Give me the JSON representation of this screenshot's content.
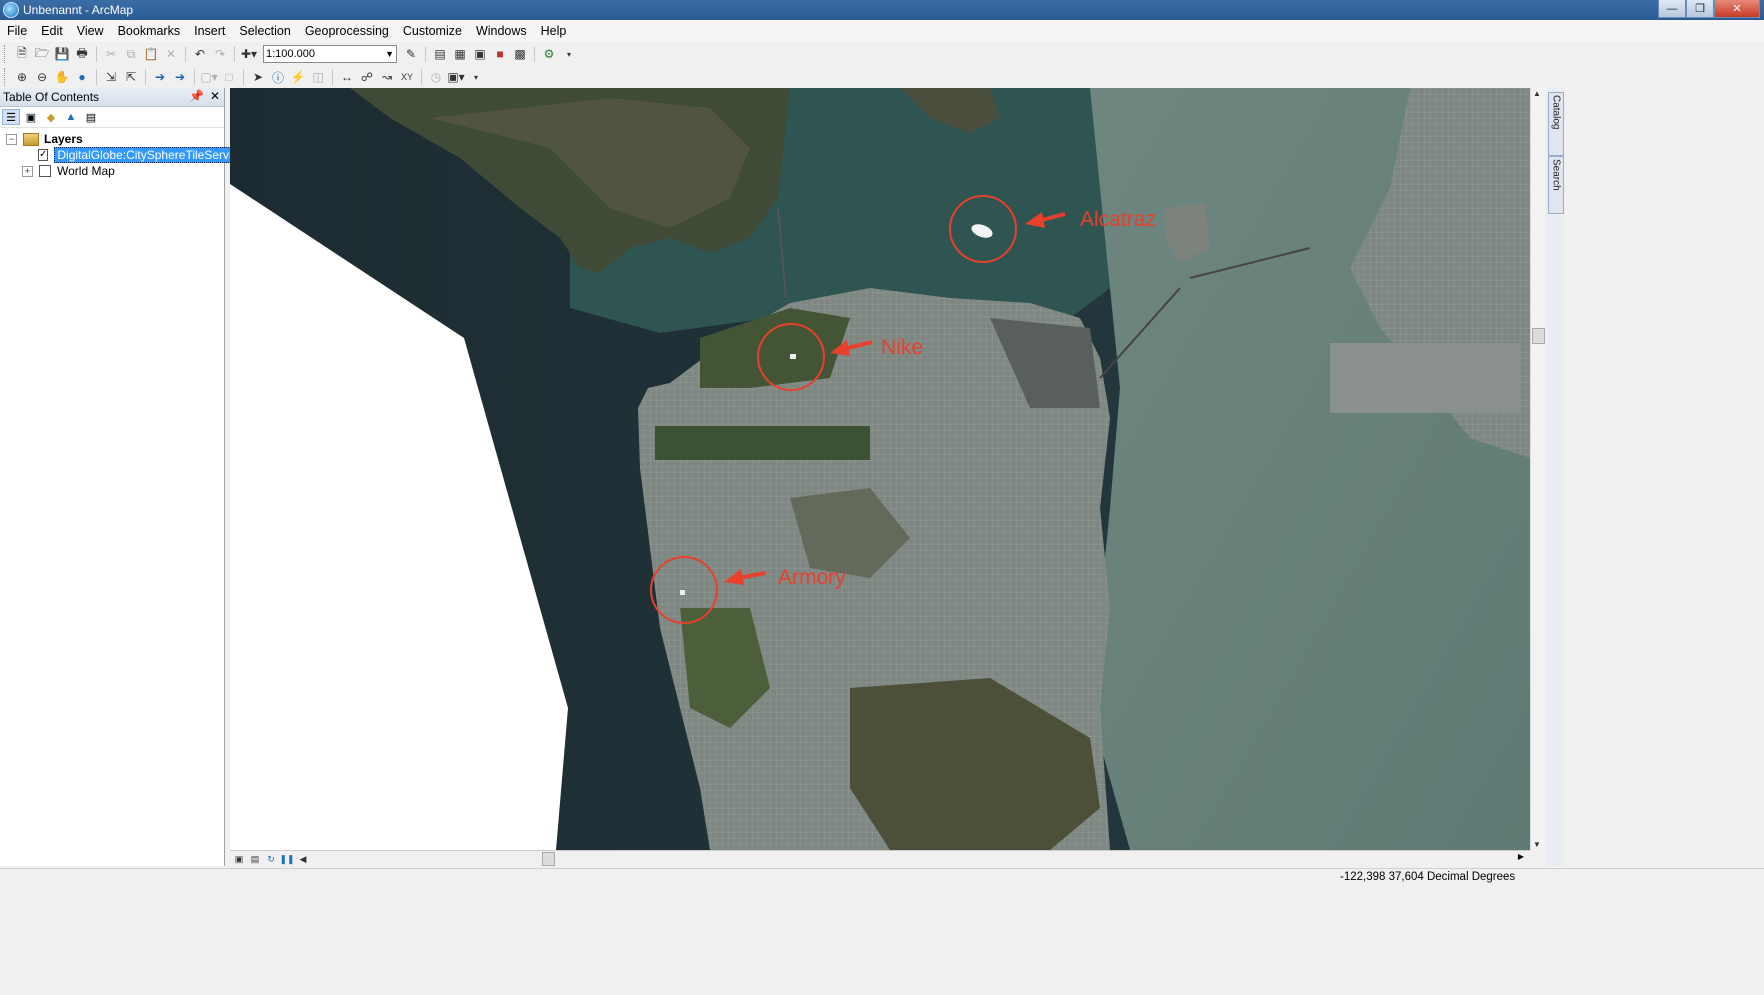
{
  "window": {
    "title": "Unbenannt - ArcMap"
  },
  "menu": [
    "File",
    "Edit",
    "View",
    "Bookmarks",
    "Insert",
    "Selection",
    "Geoprocessing",
    "Customize",
    "Windows",
    "Help"
  ],
  "toolbar": {
    "scale_value": "1:100.000"
  },
  "toc": {
    "title": "Table Of Contents",
    "root_label": "Layers",
    "layers": [
      {
        "label": "DigitalGlobe:CitySphereTileService",
        "checked": true,
        "selected": true
      },
      {
        "label": "World Map",
        "checked": false,
        "selected": false
      }
    ]
  },
  "map": {
    "annotations": [
      {
        "label": "Alcatraz"
      },
      {
        "label": "Nike"
      },
      {
        "label": "Armory"
      }
    ],
    "annotation_color": "#e8402a"
  },
  "sidetabs": [
    "Catalog",
    "Search"
  ],
  "status": {
    "coordinates": "-122,398  37,604 Decimal Degrees"
  },
  "colors": {
    "titlebar": "#2f6299",
    "selection": "#3399ff",
    "water_bay": "#2d5450",
    "ocean": "#1f3136"
  }
}
